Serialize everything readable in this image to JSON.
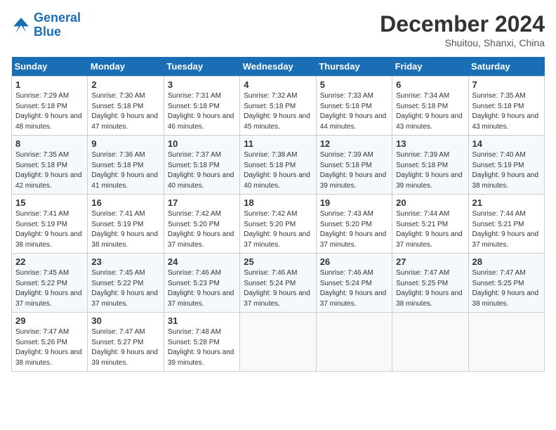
{
  "header": {
    "logo_line1": "General",
    "logo_line2": "Blue",
    "month_title": "December 2024",
    "subtitle": "Shuitou, Shanxi, China"
  },
  "weekdays": [
    "Sunday",
    "Monday",
    "Tuesday",
    "Wednesday",
    "Thursday",
    "Friday",
    "Saturday"
  ],
  "weeks": [
    [
      {
        "day": "1",
        "sunrise": "Sunrise: 7:29 AM",
        "sunset": "Sunset: 5:18 PM",
        "daylight": "Daylight: 9 hours and 48 minutes."
      },
      {
        "day": "2",
        "sunrise": "Sunrise: 7:30 AM",
        "sunset": "Sunset: 5:18 PM",
        "daylight": "Daylight: 9 hours and 47 minutes."
      },
      {
        "day": "3",
        "sunrise": "Sunrise: 7:31 AM",
        "sunset": "Sunset: 5:18 PM",
        "daylight": "Daylight: 9 hours and 46 minutes."
      },
      {
        "day": "4",
        "sunrise": "Sunrise: 7:32 AM",
        "sunset": "Sunset: 5:18 PM",
        "daylight": "Daylight: 9 hours and 45 minutes."
      },
      {
        "day": "5",
        "sunrise": "Sunrise: 7:33 AM",
        "sunset": "Sunset: 5:18 PM",
        "daylight": "Daylight: 9 hours and 44 minutes."
      },
      {
        "day": "6",
        "sunrise": "Sunrise: 7:34 AM",
        "sunset": "Sunset: 5:18 PM",
        "daylight": "Daylight: 9 hours and 43 minutes."
      },
      {
        "day": "7",
        "sunrise": "Sunrise: 7:35 AM",
        "sunset": "Sunset: 5:18 PM",
        "daylight": "Daylight: 9 hours and 43 minutes."
      }
    ],
    [
      {
        "day": "8",
        "sunrise": "Sunrise: 7:35 AM",
        "sunset": "Sunset: 5:18 PM",
        "daylight": "Daylight: 9 hours and 42 minutes."
      },
      {
        "day": "9",
        "sunrise": "Sunrise: 7:36 AM",
        "sunset": "Sunset: 5:18 PM",
        "daylight": "Daylight: 9 hours and 41 minutes."
      },
      {
        "day": "10",
        "sunrise": "Sunrise: 7:37 AM",
        "sunset": "Sunset: 5:18 PM",
        "daylight": "Daylight: 9 hours and 40 minutes."
      },
      {
        "day": "11",
        "sunrise": "Sunrise: 7:38 AM",
        "sunset": "Sunset: 5:18 PM",
        "daylight": "Daylight: 9 hours and 40 minutes."
      },
      {
        "day": "12",
        "sunrise": "Sunrise: 7:39 AM",
        "sunset": "Sunset: 5:18 PM",
        "daylight": "Daylight: 9 hours and 39 minutes."
      },
      {
        "day": "13",
        "sunrise": "Sunrise: 7:39 AM",
        "sunset": "Sunset: 5:18 PM",
        "daylight": "Daylight: 9 hours and 39 minutes."
      },
      {
        "day": "14",
        "sunrise": "Sunrise: 7:40 AM",
        "sunset": "Sunset: 5:19 PM",
        "daylight": "Daylight: 9 hours and 38 minutes."
      }
    ],
    [
      {
        "day": "15",
        "sunrise": "Sunrise: 7:41 AM",
        "sunset": "Sunset: 5:19 PM",
        "daylight": "Daylight: 9 hours and 38 minutes."
      },
      {
        "day": "16",
        "sunrise": "Sunrise: 7:41 AM",
        "sunset": "Sunset: 5:19 PM",
        "daylight": "Daylight: 9 hours and 38 minutes."
      },
      {
        "day": "17",
        "sunrise": "Sunrise: 7:42 AM",
        "sunset": "Sunset: 5:20 PM",
        "daylight": "Daylight: 9 hours and 37 minutes."
      },
      {
        "day": "18",
        "sunrise": "Sunrise: 7:42 AM",
        "sunset": "Sunset: 5:20 PM",
        "daylight": "Daylight: 9 hours and 37 minutes."
      },
      {
        "day": "19",
        "sunrise": "Sunrise: 7:43 AM",
        "sunset": "Sunset: 5:20 PM",
        "daylight": "Daylight: 9 hours and 37 minutes."
      },
      {
        "day": "20",
        "sunrise": "Sunrise: 7:44 AM",
        "sunset": "Sunset: 5:21 PM",
        "daylight": "Daylight: 9 hours and 37 minutes."
      },
      {
        "day": "21",
        "sunrise": "Sunrise: 7:44 AM",
        "sunset": "Sunset: 5:21 PM",
        "daylight": "Daylight: 9 hours and 37 minutes."
      }
    ],
    [
      {
        "day": "22",
        "sunrise": "Sunrise: 7:45 AM",
        "sunset": "Sunset: 5:22 PM",
        "daylight": "Daylight: 9 hours and 37 minutes."
      },
      {
        "day": "23",
        "sunrise": "Sunrise: 7:45 AM",
        "sunset": "Sunset: 5:22 PM",
        "daylight": "Daylight: 9 hours and 37 minutes."
      },
      {
        "day": "24",
        "sunrise": "Sunrise: 7:46 AM",
        "sunset": "Sunset: 5:23 PM",
        "daylight": "Daylight: 9 hours and 37 minutes."
      },
      {
        "day": "25",
        "sunrise": "Sunrise: 7:46 AM",
        "sunset": "Sunset: 5:24 PM",
        "daylight": "Daylight: 9 hours and 37 minutes."
      },
      {
        "day": "26",
        "sunrise": "Sunrise: 7:46 AM",
        "sunset": "Sunset: 5:24 PM",
        "daylight": "Daylight: 9 hours and 37 minutes."
      },
      {
        "day": "27",
        "sunrise": "Sunrise: 7:47 AM",
        "sunset": "Sunset: 5:25 PM",
        "daylight": "Daylight: 9 hours and 38 minutes."
      },
      {
        "day": "28",
        "sunrise": "Sunrise: 7:47 AM",
        "sunset": "Sunset: 5:25 PM",
        "daylight": "Daylight: 9 hours and 38 minutes."
      }
    ],
    [
      {
        "day": "29",
        "sunrise": "Sunrise: 7:47 AM",
        "sunset": "Sunset: 5:26 PM",
        "daylight": "Daylight: 9 hours and 38 minutes."
      },
      {
        "day": "30",
        "sunrise": "Sunrise: 7:47 AM",
        "sunset": "Sunset: 5:27 PM",
        "daylight": "Daylight: 9 hours and 39 minutes."
      },
      {
        "day": "31",
        "sunrise": "Sunrise: 7:48 AM",
        "sunset": "Sunset: 5:28 PM",
        "daylight": "Daylight: 9 hours and 39 minutes."
      },
      null,
      null,
      null,
      null
    ]
  ]
}
